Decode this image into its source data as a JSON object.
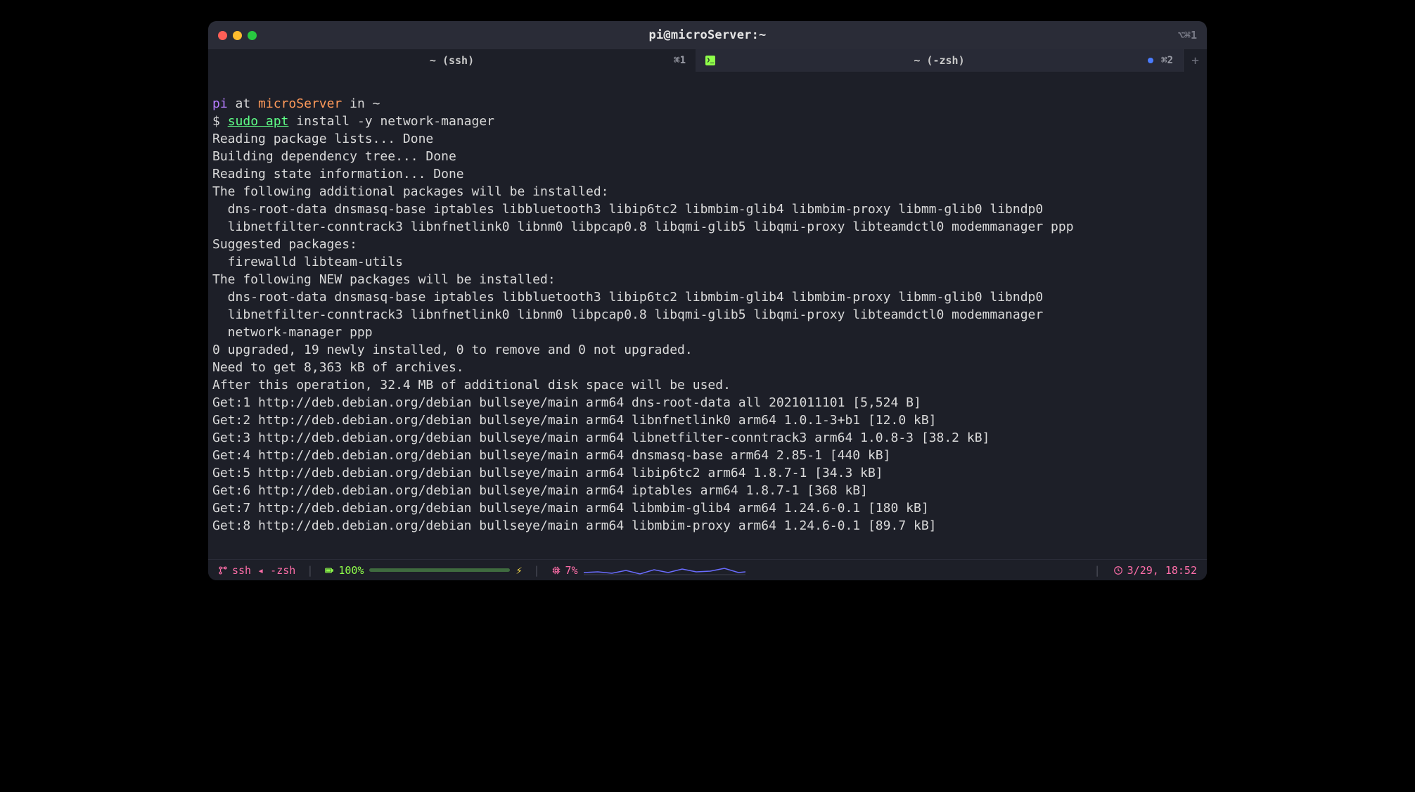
{
  "titlebar": {
    "title": "pi@microServer:~",
    "alt_shortcut": "⌥⌘1"
  },
  "tabs": [
    {
      "label": "~ (ssh)",
      "shortcut": "⌘1"
    },
    {
      "label": "~ (-zsh)",
      "shortcut": "⌘2"
    }
  ],
  "prompt": {
    "user": "pi",
    "at": " at ",
    "host": "microServer",
    "in": " in ",
    "cwd": "~",
    "dollar": "$ ",
    "sudo": "sudo",
    "apt": " apt",
    "rest": " install -y network-manager"
  },
  "output": [
    "Reading package lists... Done",
    "Building dependency tree... Done",
    "Reading state information... Done",
    "The following additional packages will be installed:",
    "  dns-root-data dnsmasq-base iptables libbluetooth3 libip6tc2 libmbim-glib4 libmbim-proxy libmm-glib0 libndp0",
    "  libnetfilter-conntrack3 libnfnetlink0 libnm0 libpcap0.8 libqmi-glib5 libqmi-proxy libteamdctl0 modemmanager ppp",
    "Suggested packages:",
    "  firewalld libteam-utils",
    "The following NEW packages will be installed:",
    "  dns-root-data dnsmasq-base iptables libbluetooth3 libip6tc2 libmbim-glib4 libmbim-proxy libmm-glib0 libndp0",
    "  libnetfilter-conntrack3 libnfnetlink0 libnm0 libpcap0.8 libqmi-glib5 libqmi-proxy libteamdctl0 modemmanager",
    "  network-manager ppp",
    "0 upgraded, 19 newly installed, 0 to remove and 0 not upgraded.",
    "Need to get 8,363 kB of archives.",
    "After this operation, 32.4 MB of additional disk space will be used.",
    "Get:1 http://deb.debian.org/debian bullseye/main arm64 dns-root-data all 2021011101 [5,524 B]",
    "Get:2 http://deb.debian.org/debian bullseye/main arm64 libnfnetlink0 arm64 1.0.1-3+b1 [12.0 kB]",
    "Get:3 http://deb.debian.org/debian bullseye/main arm64 libnetfilter-conntrack3 arm64 1.0.8-3 [38.2 kB]",
    "Get:4 http://deb.debian.org/debian bullseye/main arm64 dnsmasq-base arm64 2.85-1 [440 kB]",
    "Get:5 http://deb.debian.org/debian bullseye/main arm64 libip6tc2 arm64 1.8.7-1 [34.3 kB]",
    "Get:6 http://deb.debian.org/debian bullseye/main arm64 iptables arm64 1.8.7-1 [368 kB]",
    "Get:7 http://deb.debian.org/debian bullseye/main arm64 libmbim-glib4 arm64 1.24.6-0.1 [180 kB]",
    "Get:8 http://deb.debian.org/debian bullseye/main arm64 libmbim-proxy arm64 1.24.6-0.1 [89.7 kB]"
  ],
  "status": {
    "left": "ssh ◂ -zsh",
    "battery": "100%",
    "cpu": "7%",
    "datetime": "3/29, 18:52"
  }
}
